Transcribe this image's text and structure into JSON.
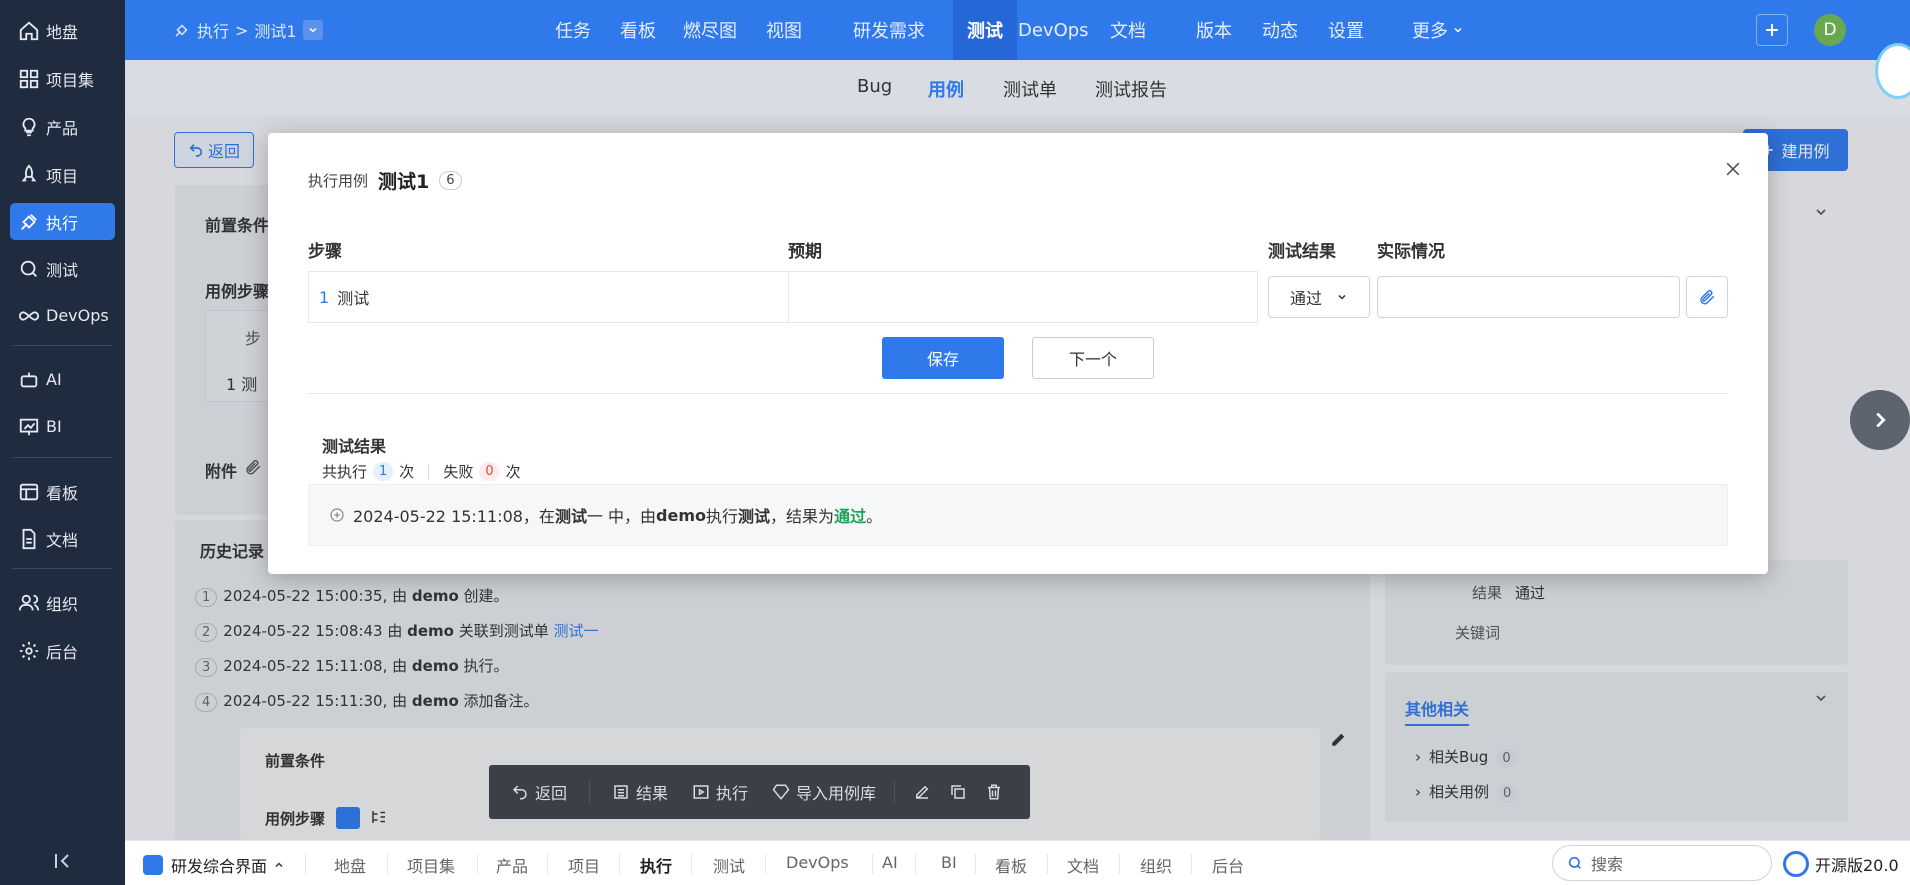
{
  "sidebar": {
    "items": [
      {
        "label": "地盘",
        "icon": "home-icon"
      },
      {
        "label": "项目集",
        "icon": "grid-icon"
      },
      {
        "label": "产品",
        "icon": "bulb-icon"
      },
      {
        "label": "项目",
        "icon": "rocket-icon"
      },
      {
        "label": "执行",
        "icon": "run-icon",
        "active": true
      },
      {
        "label": "测试",
        "icon": "test-icon"
      },
      {
        "label": "DevOps",
        "icon": "infinity-icon"
      },
      {
        "label": "AI",
        "icon": "robot-icon"
      },
      {
        "label": "BI",
        "icon": "chart-icon"
      },
      {
        "label": "看板",
        "icon": "kanban-icon"
      },
      {
        "label": "文档",
        "icon": "doc-icon"
      },
      {
        "label": "组织",
        "icon": "users-icon"
      },
      {
        "label": "后台",
        "icon": "gear-icon"
      }
    ]
  },
  "header": {
    "breadcrumb": {
      "root": "执行",
      "sep": ">",
      "current": "测试1"
    },
    "nav": [
      "任务",
      "看板",
      "燃尽图",
      "视图",
      "研发需求",
      "测试",
      "DevOps",
      "文档",
      "版本",
      "动态",
      "设置",
      "更多"
    ],
    "active_nav": "测试",
    "avatar": "D"
  },
  "subnav": {
    "tabs": [
      "Bug",
      "用例",
      "测试单",
      "测试报告"
    ],
    "active": "用例"
  },
  "background": {
    "back_label": "返回",
    "create_label": "建用例",
    "precondition": "前置条件",
    "steps": "用例步骤",
    "step_col": "步",
    "step_row": "1  测",
    "attachments": "附件",
    "history": "历史记录",
    "history_items": [
      {
        "n": "1",
        "time": "2024-05-22 15:00:35, 由 ",
        "user": "demo",
        "action": " 创建。",
        "link": ""
      },
      {
        "n": "2",
        "time": "2024-05-22 15:08:43 由 ",
        "user": "demo",
        "action": " 关联到测试单 ",
        "link": "测试一"
      },
      {
        "n": "3",
        "time": "2024-05-22 15:11:08, 由 ",
        "user": "demo",
        "action": " 执行。",
        "link": ""
      },
      {
        "n": "4",
        "time": "2024-05-22 15:11:30, 由 ",
        "user": "demo",
        "action": " 添加备注。",
        "link": ""
      }
    ],
    "note_precondition": "前置条件",
    "note_steps": "用例步骤",
    "right_result_label": "结果",
    "right_result_value": "通过",
    "right_keywords": "关键词",
    "other_related": "其他相关",
    "related_bug": "相关Bug",
    "related_bug_count": "0",
    "related_case": "相关用例",
    "related_case_count": "0"
  },
  "modal": {
    "label": "执行用例",
    "title": "测试1",
    "count": "6",
    "columns": {
      "steps": "步骤",
      "expected": "预期",
      "result": "测试结果",
      "actual": "实际情况"
    },
    "step": {
      "index": "1",
      "text": "测试",
      "expected": ""
    },
    "result_value": "通过",
    "actual_value": "",
    "save_label": "保存",
    "next_label": "下一个",
    "results_heading": "测试结果",
    "summary": {
      "total_prefix": "共执行",
      "total_count": "1",
      "total_suffix": "次",
      "fail_prefix": "失败",
      "fail_count": "0",
      "fail_suffix": "次"
    },
    "log": {
      "prefix": "2024-05-22 15:11:08，在 ",
      "run": "测试",
      "run_suffix": "一 中，由 ",
      "user": "demo",
      "mid": " 执行 ",
      "case": "测试",
      "tail": "，结果为 ",
      "result": "通过",
      "end": "。"
    }
  },
  "actionbar": {
    "items": [
      "返回",
      "结果",
      "执行",
      "导入用例库"
    ]
  },
  "bottombar": {
    "app": "研发综合界面",
    "tabs": [
      "地盘",
      "项目集",
      "产品",
      "项目",
      "执行",
      "测试",
      "DevOps",
      "AI",
      "BI",
      "看板",
      "文档",
      "组织",
      "后台"
    ],
    "active": "执行",
    "search_placeholder": "搜索",
    "version": "开源版20.0"
  },
  "colors": {
    "primary": "#2f79eb",
    "sidebar": "#1f2b3e",
    "pass": "#1aa35a",
    "fail": "#e04b3c"
  }
}
